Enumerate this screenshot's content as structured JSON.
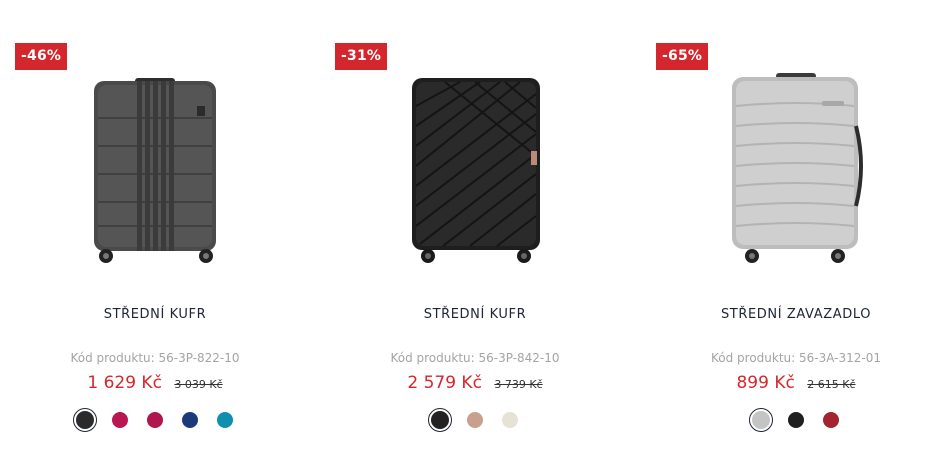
{
  "products": [
    {
      "discount": "-46%",
      "title": "STŘEDNÍ KUFR",
      "code": "Kód produktu: 56-3P-822-10",
      "price": "1 629 Kč",
      "old_price": "3 039 Kč",
      "image_icon": "grey-suitcase-icon",
      "colors": [
        "#2b2b2b",
        "#b8174f",
        "#b0154d",
        "#1c3a7a",
        "#0f8fb0"
      ]
    },
    {
      "discount": "-31%",
      "title": "STŘEDNÍ KUFR",
      "code": "Kód produktu: 56-3P-842-10",
      "price": "2 579 Kč",
      "old_price": "3 739 Kč",
      "image_icon": "black-suitcase-icon",
      "colors": [
        "#222222",
        "#c9a08d",
        "#e6e2d6"
      ]
    },
    {
      "discount": "-65%",
      "title": "STŘEDNÍ ZAVAZADLO",
      "code": "Kód produktu: 56-3A-312-01",
      "price": "899 Kč",
      "old_price": "2 615 Kč",
      "image_icon": "silver-suitcase-icon",
      "colors": [
        "#c4c4c4",
        "#1f1f1f",
        "#a3242f"
      ]
    }
  ],
  "accent": "#d3272d"
}
